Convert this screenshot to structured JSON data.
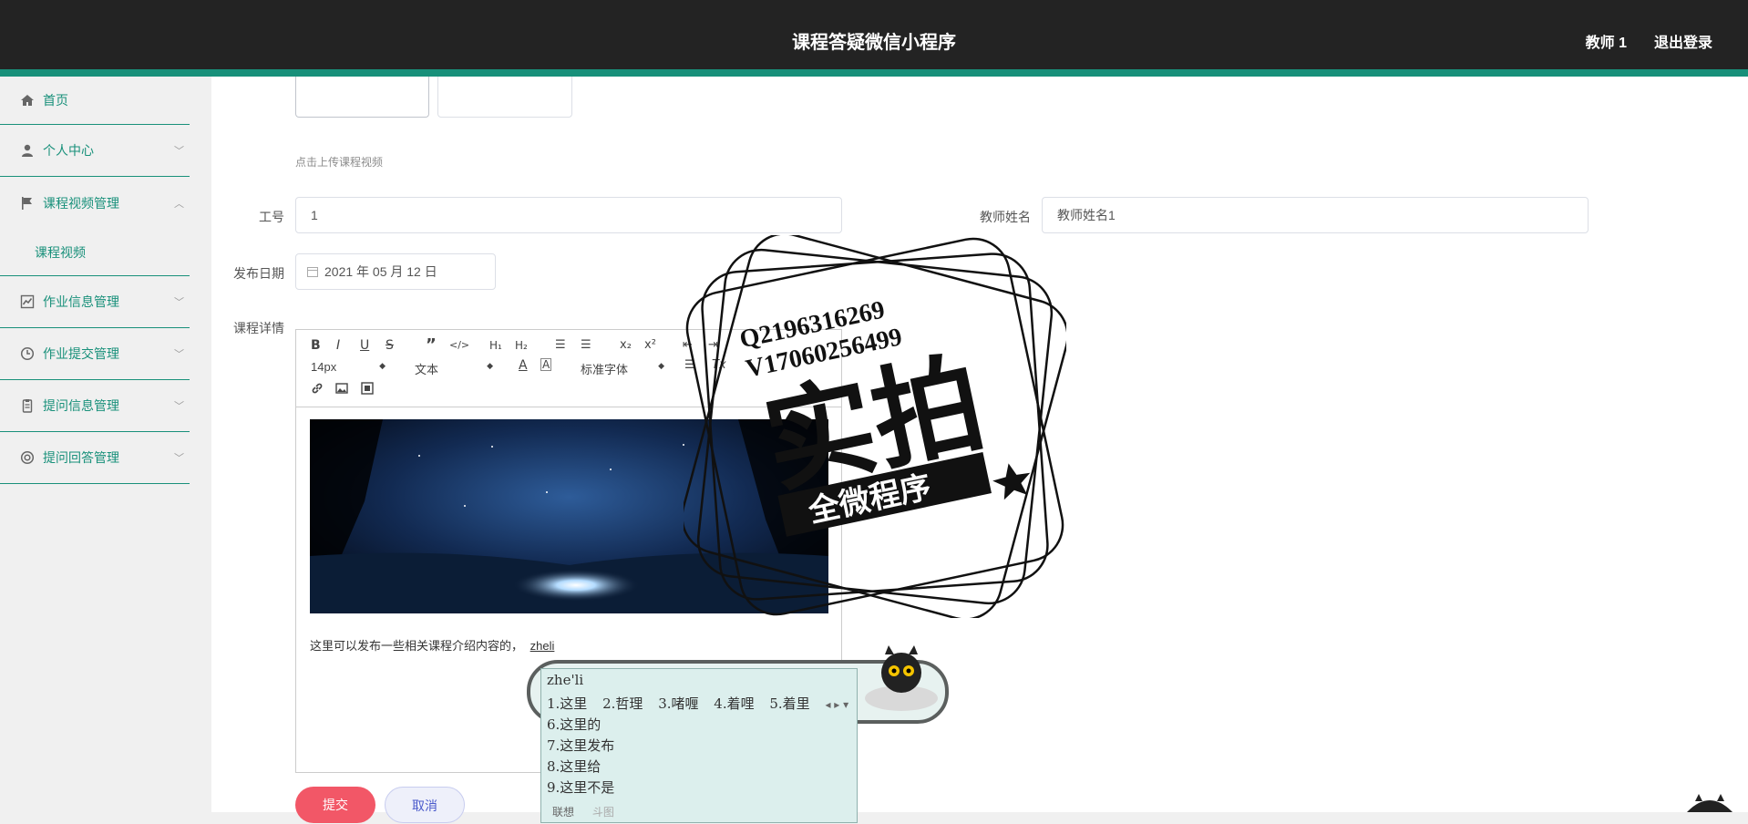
{
  "header": {
    "title": "课程答疑微信小程序",
    "user": "教师 1",
    "logout": "退出登录"
  },
  "sidebar": {
    "items": [
      {
        "label": "首页",
        "icon": "home-icon",
        "chevron": ""
      },
      {
        "label": "个人中心",
        "icon": "person-icon",
        "chevron": "﹀"
      },
      {
        "label": "课程视频管理",
        "icon": "flag-icon",
        "chevron": "︿"
      },
      {
        "label": "作业信息管理",
        "icon": "chart-icon",
        "chevron": "﹀"
      },
      {
        "label": "作业提交管理",
        "icon": "clock-icon",
        "chevron": "﹀"
      },
      {
        "label": "提问信息管理",
        "icon": "clipboard-icon",
        "chevron": "﹀"
      },
      {
        "label": "提问回答管理",
        "icon": "lifebuoy-icon",
        "chevron": "﹀"
      }
    ],
    "subitem": "课程视频"
  },
  "form": {
    "upload_hint": "点击上传课程视频",
    "job_no_label": "工号",
    "job_no_value": "1",
    "teacher_name_label": "教师姓名",
    "teacher_name_value": "教师姓名1",
    "publish_date_label": "发布日期",
    "publish_date_value": "2021 年 05 月 12 日",
    "details_label": "课程详情"
  },
  "editor": {
    "font_size": "14px",
    "header_select": "文本",
    "font_family": "标准字体",
    "content_text": "这里可以发布一些相关课程介绍内容的，",
    "typing": "zheli"
  },
  "buttons": {
    "submit": "提交",
    "cancel": "取消"
  },
  "ime": {
    "pinyin": "zhe'li",
    "candidates_row": [
      "1.这里",
      "2.哲理",
      "3.啫喱",
      "4.着哩",
      "5.着里"
    ],
    "candidates_more": [
      "6.这里的",
      "7.这里发布",
      "8.这里给",
      "9.这里不是"
    ],
    "footer_active": "联想",
    "footer_inactive": "斗图"
  },
  "watermark": {
    "line1": "Q2196316269",
    "line2": "V17060256499",
    "big": "实拍",
    "banner": "全微程序"
  }
}
